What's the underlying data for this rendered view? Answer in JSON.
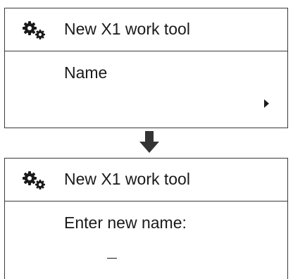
{
  "screen1": {
    "title": "New X1 work tool",
    "item_label": "Name",
    "icons": {
      "header": "gears-icon",
      "item": "arrow-right-icon"
    }
  },
  "transition": {
    "icon": "down-arrow-icon"
  },
  "screen2": {
    "title": "New X1 work tool",
    "prompt": "Enter new name:",
    "cursor": "_",
    "icons": {
      "header": "gears-icon"
    }
  },
  "colors": {
    "text": "#1a1a1a",
    "border": "#3a3a3a",
    "background": "#ffffff"
  }
}
